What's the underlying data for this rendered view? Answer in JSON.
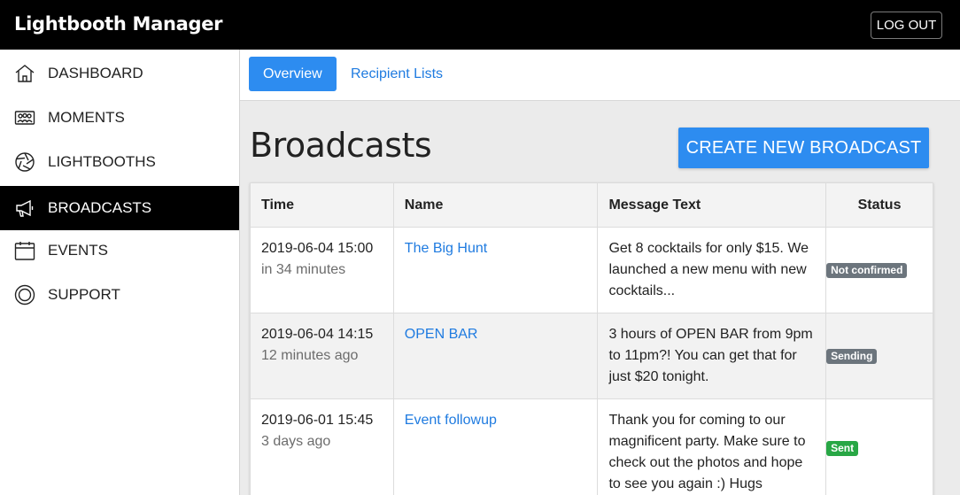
{
  "app": {
    "title": "Lightbooth Manager",
    "logout_label": "LOG OUT"
  },
  "sidebar": {
    "items": [
      {
        "label": "DASHBOARD",
        "icon": "home-icon",
        "active": false
      },
      {
        "label": "MOMENTS",
        "icon": "people-photo-icon",
        "active": false
      },
      {
        "label": "LIGHTBOOTHS",
        "icon": "aperture-icon",
        "active": false
      },
      {
        "label": "BROADCASTS",
        "icon": "megaphone-icon",
        "active": true
      },
      {
        "label": "EVENTS",
        "icon": "calendar-icon",
        "active": false
      },
      {
        "label": "SUPPORT",
        "icon": "lifebuoy-icon",
        "active": false
      }
    ]
  },
  "tabs": [
    {
      "label": "Overview",
      "active": true
    },
    {
      "label": "Recipient Lists",
      "active": false
    }
  ],
  "page": {
    "title": "Broadcasts",
    "create_label": "CREATE NEW BROADCAST"
  },
  "table": {
    "headers": [
      "Time",
      "Name",
      "Message Text",
      "Status"
    ],
    "rows": [
      {
        "time": "2019-06-04 15:00",
        "relative": "in 34 minutes",
        "name": "The Big Hunt",
        "message": "Get 8 cocktails for only $15. We launched a new menu with new cocktails...",
        "status": "Not confirmed"
      },
      {
        "time": "2019-06-04 14:15",
        "relative": "12 minutes ago",
        "name": "OPEN BAR",
        "message": "3 hours of OPEN BAR from 9pm to 11pm?! You can get that for just $20 tonight.",
        "status": "Sending"
      },
      {
        "time": "2019-06-01 15:45",
        "relative": "3 days ago",
        "name": "Event followup",
        "message": "Thank you for coming to our magnificent party. Make sure to check out the photos and hope to see you again :) Hugs",
        "status": "Sent"
      }
    ]
  },
  "colors": {
    "accent": "#2d8cf0",
    "link": "#1f7be0",
    "badge_grey": "#6c757d",
    "badge_green": "#28a745"
  }
}
